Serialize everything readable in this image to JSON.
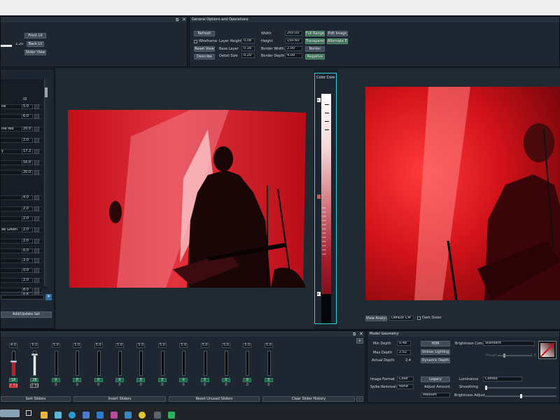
{
  "general_panel": {
    "title": "General Options and Operations",
    "refresh": "Refresh",
    "wireframe": "Wireframe",
    "reset_view": "Reset View",
    "describe": "Describe",
    "layer_height_label": "Layer Height",
    "layer_height": "0.08",
    "base_layer_label": "Base Layer",
    "base_layer": "0.16",
    "detail_size_label": "Detail Size",
    "detail_size": "0.20",
    "width_label": "Width",
    "width": "200.00",
    "height_label": "Height",
    "height": "150.60",
    "border_width_label": "Border Width",
    "border_width": "2.00",
    "border_depth_label": "Border Depth",
    "border_depth": "4.00",
    "full_range": "Full Range",
    "edit_image": "Edit Image",
    "transparent": "Transparent",
    "alternate_edit": "Alternate Edit",
    "border": "Border",
    "negative": "Negative"
  },
  "lit_panel": {
    "front_lit": "Front Lit",
    "back_lit": "Back Lit",
    "slider_view": "Slider View",
    "value": "1.20"
  },
  "layer_list": {
    "header1": "ID",
    "header2": "ID",
    "rows": [
      {
        "name": "ite",
        "value": "5.0"
      },
      {
        "name": "",
        "value": "6.0"
      },
      {
        "name": "ine red",
        "value": "20.0"
      },
      {
        "name": "",
        "value": "2.0"
      },
      {
        "name": "y",
        "value": "17.2"
      },
      {
        "name": "",
        "value": "16.0"
      },
      {
        "name": "",
        "value": "20.0"
      },
      {
        "name": "",
        "value": "4.0"
      },
      {
        "name": "",
        "value": "2.0"
      },
      {
        "name": "",
        "value": "2.0"
      },
      {
        "name": "ab Green",
        "value": "2.0"
      },
      {
        "name": "",
        "value": "2.0"
      },
      {
        "name": "",
        "value": "0.0"
      },
      {
        "name": "",
        "value": "2.0"
      },
      {
        "name": "",
        "value": "0.0"
      },
      {
        "name": "",
        "value": "2.0"
      },
      {
        "name": "",
        "value": "8.0"
      },
      {
        "name": "",
        "value": "0.6"
      }
    ],
    "add_update": "Add/Update Set"
  },
  "color_core": {
    "title": "Color Core",
    "labels": [
      "131",
      "131",
      "131",
      "131",
      "131",
      "131",
      "131",
      "131",
      "131",
      "131",
      "131",
      "131"
    ]
  },
  "view_controls": {
    "view_analysis": "View Analysis",
    "default_cm": "Default CM",
    "dark_outer": "Dark Outer"
  },
  "mixer": {
    "top_values": [
      "4.0",
      "5.0",
      "5.0",
      "5.0",
      "5.0",
      "5.0",
      "5.0",
      "5.0",
      "5.0",
      "5.0",
      "5.0",
      "5.0",
      "5.0"
    ],
    "chip_values": [
      "18",
      "28",
      "0",
      "0",
      "0",
      "0",
      "0",
      "0",
      "0",
      "0",
      "0",
      "0",
      "0"
    ],
    "bottom_values": [
      "1.52",
      "2.32",
      "0",
      "0",
      "0",
      "0",
      "0",
      "0",
      "0",
      "0",
      "0",
      "0",
      "0"
    ],
    "sort": "Sort Sliders",
    "insert": "Insert Sliders",
    "reset": "Reset Unused Sliders",
    "clear": "Clear Slider History"
  },
  "model_geometry": {
    "title": "Model Geometry",
    "min_depth_label": "Min Depth",
    "min_depth": "0.48",
    "max_depth_label": "Max Depth",
    "max_depth": "2.52",
    "actual_depth_label": "Actual Depth",
    "actual_depth": "2.4",
    "hdr": "HDR",
    "unbias": "Unbias Lighting",
    "dynamic_depth": "Dynamic Depth",
    "brightness_comp_label": "Brightness Comp",
    "brightness_comp": "Standard",
    "image_format_label": "Image Format",
    "image_format": "Color",
    "legacy": "Legacy",
    "spike_removal_label": "Spike Removal",
    "spike_removal": "None",
    "adjust_amount": "Adjust Amount",
    "medium": "Medium",
    "luminance_label": "Luminance",
    "luminance": "Combo",
    "smoothing": "Smoothing",
    "brightness_adjust": "Brightness Adjust",
    "preset_label": "Preset",
    "preset_val": "1.6"
  }
}
